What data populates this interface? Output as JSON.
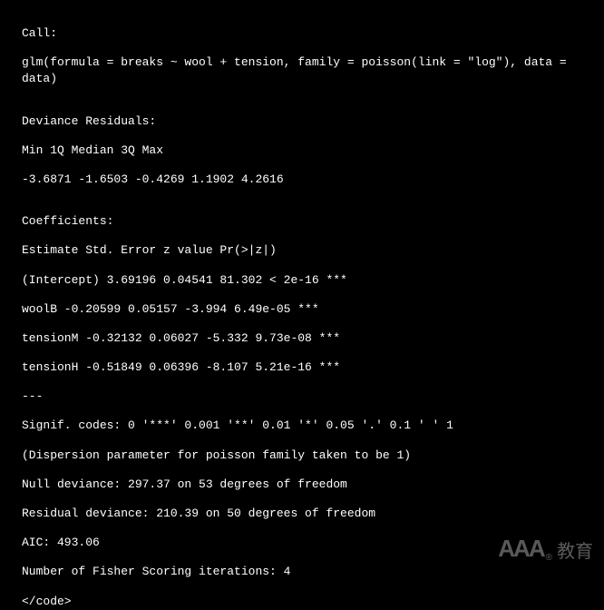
{
  "lines": {
    "l1": "Call:",
    "l2": "glm(formula = breaks ~ wool + tension, family = poisson(link = \"log\"), data = data)",
    "l3": "Deviance Residuals:",
    "l4": "Min 1Q Median 3Q Max",
    "l5": "-3.6871 -1.6503 -0.4269 1.1902 4.2616",
    "l6": "Coefficients:",
    "l7": "Estimate Std. Error z value Pr(>|z|)",
    "l8": "(Intercept) 3.69196 0.04541 81.302 < 2e-16 ***",
    "l9": "woolB -0.20599 0.05157 -3.994 6.49e-05 ***",
    "l10": "tensionM -0.32132 0.06027 -5.332 9.73e-08 ***",
    "l11": "tensionH -0.51849 0.06396 -8.107 5.21e-16 ***",
    "l12": "---",
    "l13": "Signif. codes: 0 '***' 0.001 '**' 0.01 '*' 0.05 '.' 0.1 ' ' 1",
    "l14": "(Dispersion parameter for poisson family taken to be 1)",
    "l15": "Null deviance: 297.37 on 53 degrees of freedom",
    "l16": "Residual deviance: 210.39 on 50 degrees of freedom",
    "l17": "AIC: 493.06",
    "l18": "Number of Fisher Scoring iterations: 4",
    "l19": "</code>"
  },
  "watermark": {
    "logo": "AAA",
    "reg": "®",
    "cn": "教育"
  }
}
